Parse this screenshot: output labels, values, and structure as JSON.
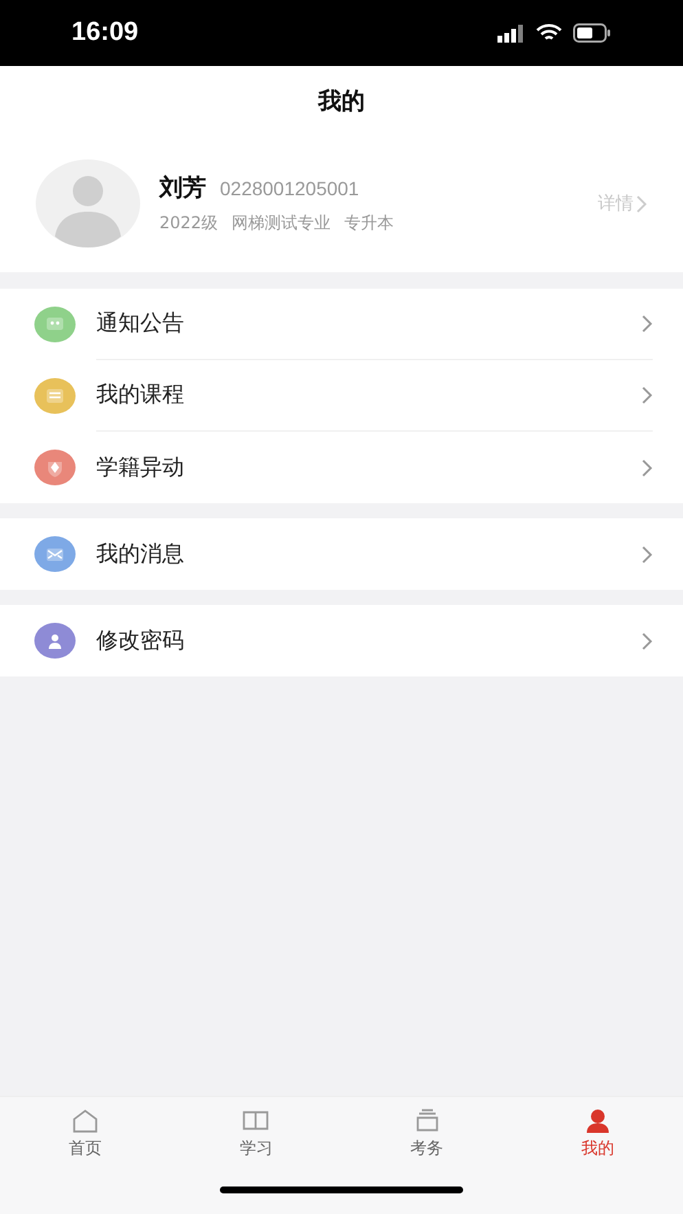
{
  "status_bar": {
    "time": "16:09"
  },
  "header": {
    "title": "我的"
  },
  "profile": {
    "name": "刘芳",
    "id": "0228001205001",
    "tags": [
      "2022级",
      "网梯测试专业",
      "专升本"
    ],
    "detail": "详情"
  },
  "menu_groups": [
    {
      "items": [
        {
          "kind": "notice",
          "label": "通知公告",
          "color": "#8fd18a"
        },
        {
          "kind": "course",
          "label": "我的课程",
          "color": "#e8c15a"
        },
        {
          "kind": "status",
          "label": "学籍异动",
          "color": "#e9877a"
        }
      ]
    },
    {
      "items": [
        {
          "kind": "message",
          "label": "我的消息",
          "color": "#7ea9e6"
        }
      ]
    },
    {
      "items": [
        {
          "kind": "password",
          "label": "修改密码",
          "color": "#8e8bd6"
        }
      ]
    }
  ],
  "tab_bar": [
    {
      "kind": "home",
      "label": "首页",
      "selected": false
    },
    {
      "kind": "study",
      "label": "学习",
      "selected": false
    },
    {
      "kind": "exam",
      "label": "考务",
      "selected": false
    },
    {
      "kind": "me",
      "label": "我的",
      "selected": true
    }
  ]
}
